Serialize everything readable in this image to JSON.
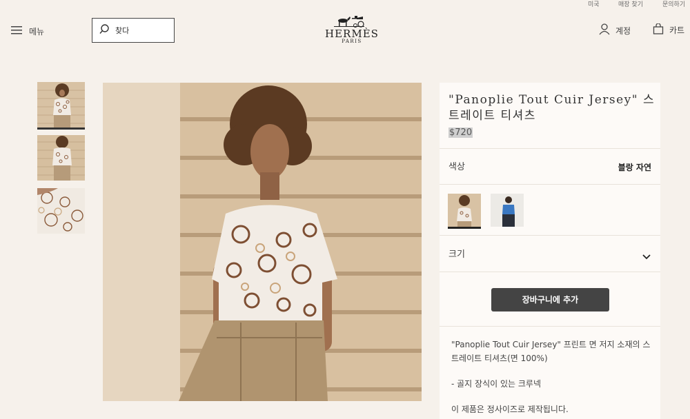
{
  "topbar": {
    "country": "미국",
    "store_finder": "매장 찾기",
    "contact": "문의하기"
  },
  "header": {
    "menu_label": "메뉴",
    "search_placeholder": "찾다",
    "brand": "HERMÈS",
    "city": "PARIS",
    "account_label": "계정",
    "cart_label": "카트"
  },
  "product": {
    "title": "\"Panoplie Tout Cuir Jersey\" 스트레이트 티셔츠",
    "price": "$720",
    "color_label": "색상",
    "color_value": "블랑 자연",
    "size_label": "크기",
    "add_to_cart": "장바구니에 추가",
    "description": [
      "\"Panoplie Tout Cuir Jersey\" 프린트 면 저지 소재의 스트레이트 티셔츠(면 100%)",
      "- 골지 장식이 있는 크루넥",
      "이 제품은 정사이즈로 제작됩니다."
    ]
  },
  "gallery": {
    "thumbnails": [
      "front-view",
      "back-view",
      "detail-view"
    ],
    "active_index": 0
  },
  "colors": [
    {
      "name": "blanc-naturel-swatch",
      "active": true
    },
    {
      "name": "blue-swatch",
      "active": false
    }
  ]
}
